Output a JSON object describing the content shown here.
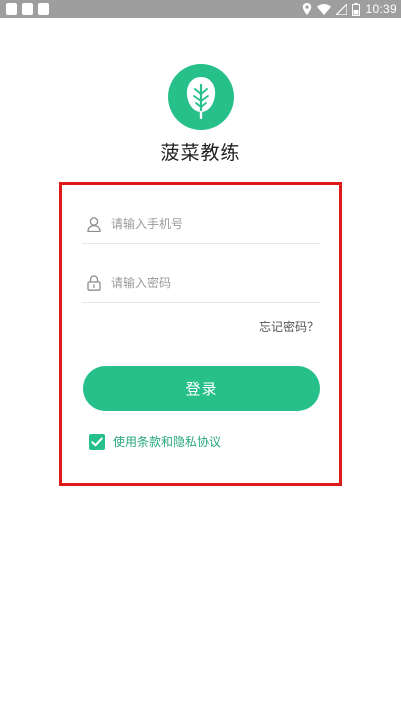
{
  "status_bar": {
    "time": "10:39",
    "icons": [
      "location-icon",
      "wifi-icon",
      "signal-icon",
      "battery-icon"
    ]
  },
  "app": {
    "name": "菠菜教练",
    "logo_icon": "spinach-leaf-icon",
    "brand_color": "#27c08a"
  },
  "login": {
    "phone": {
      "value": "",
      "placeholder": "请输入手机号",
      "icon": "user-icon"
    },
    "password": {
      "value": "",
      "placeholder": "请输入密码",
      "icon": "lock-icon"
    },
    "forgot_label": "忘记密码？",
    "submit_label": "登录",
    "agreement": {
      "checked": true,
      "label": "使用条款和隐私协议"
    }
  },
  "highlight_color": "#e01818"
}
